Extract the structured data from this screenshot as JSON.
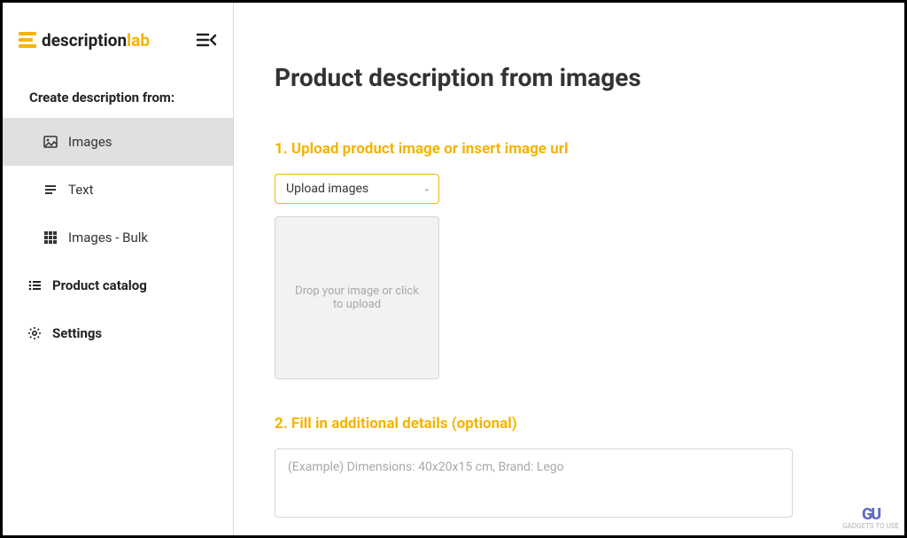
{
  "logo": {
    "text_part1": "description",
    "text_part2": "lab"
  },
  "sidebar": {
    "section_label": "Create description from:",
    "items": [
      {
        "label": "Images"
      },
      {
        "label": "Text"
      },
      {
        "label": "Images - Bulk"
      }
    ],
    "product_catalog_label": "Product catalog",
    "settings_label": "Settings"
  },
  "main": {
    "title": "Product description from images",
    "step1_heading": "1. Upload product image or insert image url",
    "upload_select_label": "Upload images",
    "dropzone_text": "Drop your image or click to upload",
    "step2_heading": "2. Fill in additional details (optional)",
    "details_placeholder": "(Example) Dimensions: 40x20x15 cm, Brand: Lego"
  },
  "watermark": {
    "logo": "GU",
    "text": "GADGETS TO USE"
  }
}
